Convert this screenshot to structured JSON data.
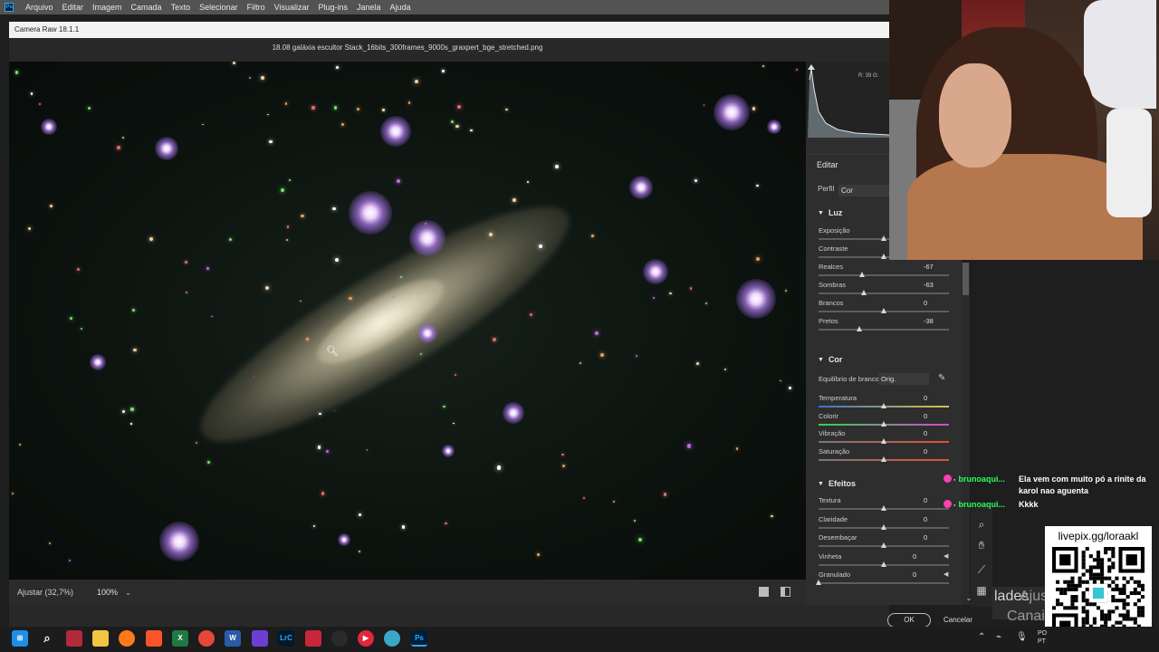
{
  "photoshop": {
    "logo": "Ps",
    "menu": [
      "Arquivo",
      "Editar",
      "Imagem",
      "Camada",
      "Texto",
      "Selecionar",
      "Filtro",
      "Visualizar",
      "Plug-ins",
      "Janela",
      "Ajuda"
    ]
  },
  "camera_raw": {
    "title": "Camera Raw 18.1.1",
    "file_name": "18.08 galáxia escultor Stack_16bits_300frames_9000s_graxpert_bge_stretched.png",
    "fit_label": "Ajustar (32,7%)",
    "zoom": "100%",
    "histogram_readout": "R: 39   G:"
  },
  "edit_panel": {
    "heading": "Editar",
    "profile_label": "Perfil",
    "profile_value": "Cor",
    "light": {
      "heading": "Luz",
      "sliders": [
        {
          "label": "Exposição",
          "value": "",
          "fraction": 0.5
        },
        {
          "label": "Contraste",
          "value": "",
          "fraction": 0.5
        },
        {
          "label": "Realces",
          "value": "-67",
          "fraction": 0.33
        },
        {
          "label": "Sombras",
          "value": "-63",
          "fraction": 0.35
        },
        {
          "label": "Brancos",
          "value": "0",
          "fraction": 0.5
        },
        {
          "label": "Pretos",
          "value": "-38",
          "fraction": 0.31
        }
      ]
    },
    "color": {
      "heading": "Cor",
      "white_balance_label": "Equilíbrio de branco",
      "white_balance_value": "Orig.",
      "sliders": [
        {
          "label": "Temperatura",
          "value": "0",
          "fraction": 0.5
        },
        {
          "label": "Colorir",
          "value": "0",
          "fraction": 0.5
        },
        {
          "label": "Vibração",
          "value": "0",
          "fraction": 0.5
        },
        {
          "label": "Saturação",
          "value": "0",
          "fraction": 0.5
        }
      ]
    },
    "effects": {
      "heading": "Efeitos",
      "sliders": [
        {
          "label": "Textura",
          "value": "0",
          "fraction": 0.5
        },
        {
          "label": "Claridade",
          "value": "0",
          "fraction": 0.5
        },
        {
          "label": "Desembaçar",
          "value": "0",
          "fraction": 0.5
        },
        {
          "label": "Vinheta",
          "value": "0",
          "fraction": 0.5
        },
        {
          "label": "Granulado",
          "value": "0",
          "fraction": 0.0
        }
      ]
    }
  },
  "buttons": {
    "ok": "OK",
    "cancel": "Cancelar"
  },
  "panel_tabs": {
    "properties": "lades",
    "adjustments": "Ajustes",
    "channels": "Canais"
  },
  "chat": [
    {
      "user": "brunoaqui...",
      "message": "Ela vem com muito pó a rinite da karol nao aguenta"
    },
    {
      "user": "brunoaqui...",
      "message": "Kkkk"
    }
  ],
  "qr": {
    "caption": "livepix.gg/loraakl"
  },
  "taskbar": {
    "apps": [
      "windows-start",
      "search",
      "app-red",
      "file-explorer",
      "firefox",
      "brave",
      "excel",
      "chrome",
      "word",
      "obsidian",
      "lightroom-classic",
      "app-news",
      "app-davinci",
      "app-red-play",
      "app-globe",
      "photoshop"
    ],
    "tray_text": "PO\nPT"
  },
  "colors": {
    "accent_green": "#2aff5a",
    "badge_pink": "#ff3fb2",
    "ps_blue": "#31a8ff"
  }
}
